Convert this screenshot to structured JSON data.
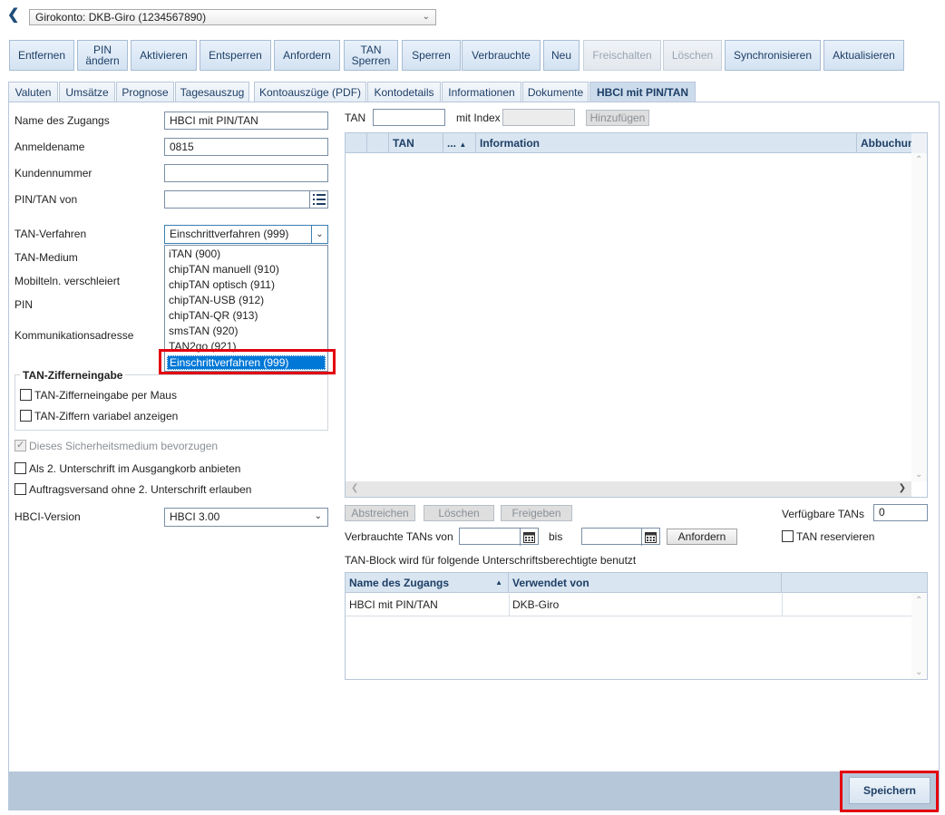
{
  "account": {
    "selected": "Girokonto: DKB-Giro (1234567890)"
  },
  "toolbar": [
    {
      "label": "Entfernen",
      "enabled": true
    },
    {
      "label": "PIN\nändern",
      "enabled": true
    },
    {
      "label": "Aktivieren",
      "enabled": true
    },
    {
      "label": "Entsperren",
      "enabled": true
    },
    {
      "label": "Anfordern",
      "enabled": true
    },
    {
      "label": "TAN\nSperren",
      "enabled": true
    },
    {
      "label": "Sperren",
      "enabled": true
    },
    {
      "label": "Verbrauchte",
      "enabled": true
    },
    {
      "label": "Neu",
      "enabled": true
    },
    {
      "label": "Freischalten",
      "enabled": false
    },
    {
      "label": "Löschen",
      "enabled": false
    },
    {
      "label": "Synchronisieren",
      "enabled": true
    },
    {
      "label": "Aktualisieren",
      "enabled": true
    }
  ],
  "tabs": [
    "Valuten",
    "Umsätze",
    "Prognose",
    "Tagesauszug",
    "Kontoauszüge (PDF)",
    "Kontodetails",
    "Informationen",
    "Dokumente",
    "HBCI mit PIN/TAN"
  ],
  "form": {
    "name_label": "Name des Zugangs",
    "name_value": "HBCI mit PIN/TAN",
    "login_label": "Anmeldename",
    "login_value": "0815",
    "customer_label": "Kundennummer",
    "customer_value": "",
    "pintan_label": "PIN/TAN von",
    "pintan_value": "",
    "tan_method_label": "TAN-Verfahren",
    "tan_method_value": "Einschrittverfahren (999)",
    "tan_medium_label": "TAN-Medium",
    "mobile_label": "Mobilteln. verschleiert",
    "pin_label": "PIN",
    "comm_label": "Kommunikationsadresse",
    "tan_options": [
      "iTAN (900)",
      "chipTAN manuell (910)",
      "chipTAN optisch (911)",
      "chipTAN-USB (912)",
      "chipTAN-QR (913)",
      "smsTAN (920)",
      "TAN2go (921)"
    ],
    "tan_selected_option": "Einschrittverfahren (999)",
    "group_title": "TAN-Zifferneingabe",
    "chk_mouse": "TAN-Zifferneingabe per Maus",
    "chk_variable": "TAN-Ziffern variabel anzeigen",
    "chk_prefer": "Dieses Sicherheitsmedium bevorzugen",
    "chk_second_sig": "Als 2. Unterschrift im Ausgangkorb anbieten",
    "chk_no_second": "Auftragsversand ohne 2. Unterschrift erlauben",
    "hbci_version_label": "HBCI-Version",
    "hbci_version_value": "HBCI 3.00"
  },
  "tan_panel": {
    "tan_label": "TAN",
    "index_label": "mit Index",
    "add_button": "Hinzufügen",
    "columns": [
      "TAN",
      "...",
      "Information",
      "Abbuchun"
    ],
    "btn_strike": "Abstreichen",
    "btn_delete": "Löschen",
    "btn_release": "Freigeben",
    "available_label": "Verfügbare TANs",
    "available_value": "0",
    "used_from_label": "Verbrauchte TANs von",
    "until_label": "bis",
    "request_button": "Anfordern",
    "reserve_label": "TAN reservieren",
    "block_text": "TAN-Block wird für folgende Unterschriftsberechtigte benutzt",
    "user_columns": [
      "Name des Zugangs",
      "Verwendet von"
    ],
    "user_rows": [
      [
        "HBCI mit PIN/TAN",
        "DKB-Giro"
      ]
    ]
  },
  "footer": {
    "save": "Speichern"
  },
  "colors": {
    "highlight": "#e3000f",
    "selection": "#0078d7",
    "header": "#d9e5f1"
  }
}
